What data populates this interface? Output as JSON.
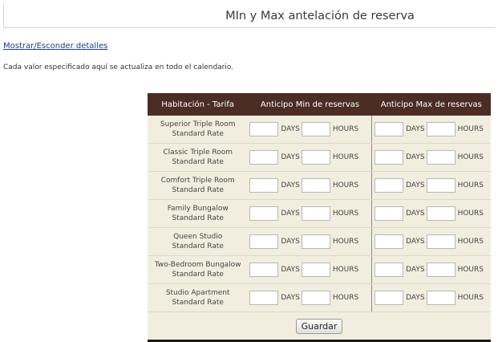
{
  "page": {
    "title": "MIn y Max antelación de reserva",
    "details_link": "Mostrar/Esconder detalles",
    "note": "Cada valor especificado aquí se actualiza en todo el calendario."
  },
  "table": {
    "headers": [
      "Habitación - Tarifa",
      "Anticipo Min de reservas",
      "Anticipo Max de reservas"
    ],
    "unit_days": "DAYS",
    "unit_hours": "HOURS",
    "rows": [
      {
        "room": "Superior Triple Room",
        "rate": "Standard Rate"
      },
      {
        "room": "Classic Triple Room",
        "rate": "Standard Rate"
      },
      {
        "room": "Comfort Triple Room",
        "rate": "Standard Rate"
      },
      {
        "room": "Family Bungalow",
        "rate": "Standard Rate"
      },
      {
        "room": "Queen Studio",
        "rate": "Standard Rate"
      },
      {
        "room": "Two-Bedroom Bungalow",
        "rate": "Standard Rate"
      },
      {
        "room": "Studio Apartment",
        "rate": "Standard Rate"
      }
    ],
    "save_label": "Guardar"
  },
  "colors": {
    "header_bg": "#4b2d25",
    "table_bg": "#f2eedf",
    "link": "#1a3d8f"
  }
}
